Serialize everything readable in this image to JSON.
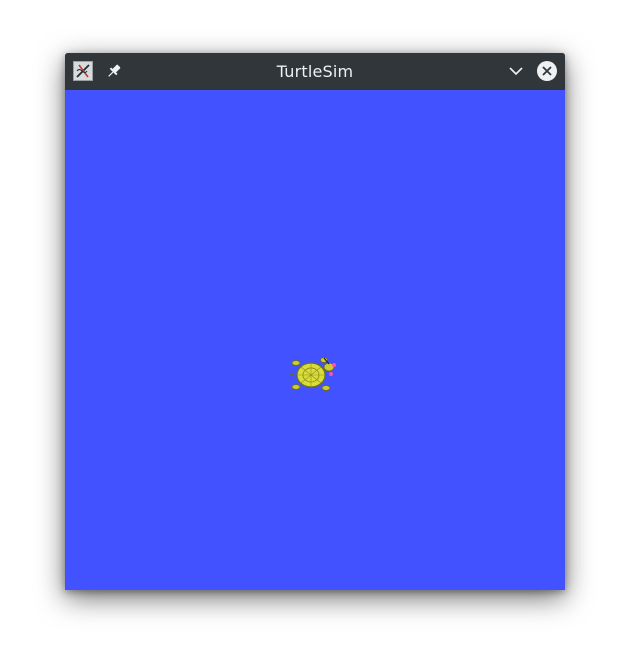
{
  "window": {
    "title": "TurtleSim",
    "icons": {
      "app": "x-app-icon",
      "pin": "pin-icon",
      "minimize": "chevron-down-icon",
      "close": "close-circle-icon"
    },
    "colors": {
      "titlebar": "#31363b",
      "title_text": "#eff0f1"
    }
  },
  "canvas": {
    "background": "#4352ff",
    "turtle": {
      "icon": "turtle-icon",
      "shell_color": "#d9dd3a"
    }
  }
}
